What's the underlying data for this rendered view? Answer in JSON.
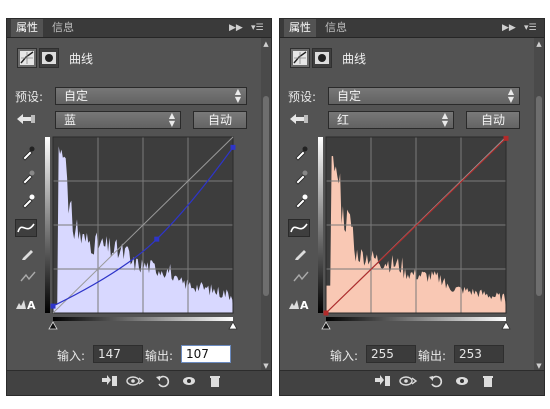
{
  "panels": [
    {
      "tabs": [
        "属性",
        "信息"
      ],
      "title": "曲线",
      "preset_label": "预设:",
      "preset_value": "自定",
      "channel_value": "蓝",
      "auto_label": "自动",
      "input_label": "输入:",
      "input_value": "147",
      "output_label": "输出:",
      "output_value": "107",
      "channel_color": "#2e35c9",
      "hist_fill": "#d8d8ff",
      "curve_points": [
        [
          0,
          10
        ],
        [
          147,
          107
        ],
        [
          255,
          240
        ]
      ]
    },
    {
      "tabs": [
        "属性",
        "信息"
      ],
      "title": "曲线",
      "preset_label": "预设:",
      "preset_value": "自定",
      "channel_value": "红",
      "auto_label": "自动",
      "input_label": "输入:",
      "input_value": "255",
      "output_label": "输出:",
      "output_value": "253",
      "channel_color": "#b22a2a",
      "hist_fill": "#f9c8b4",
      "curve_points": [
        [
          0,
          0
        ],
        [
          255,
          253
        ]
      ]
    }
  ]
}
